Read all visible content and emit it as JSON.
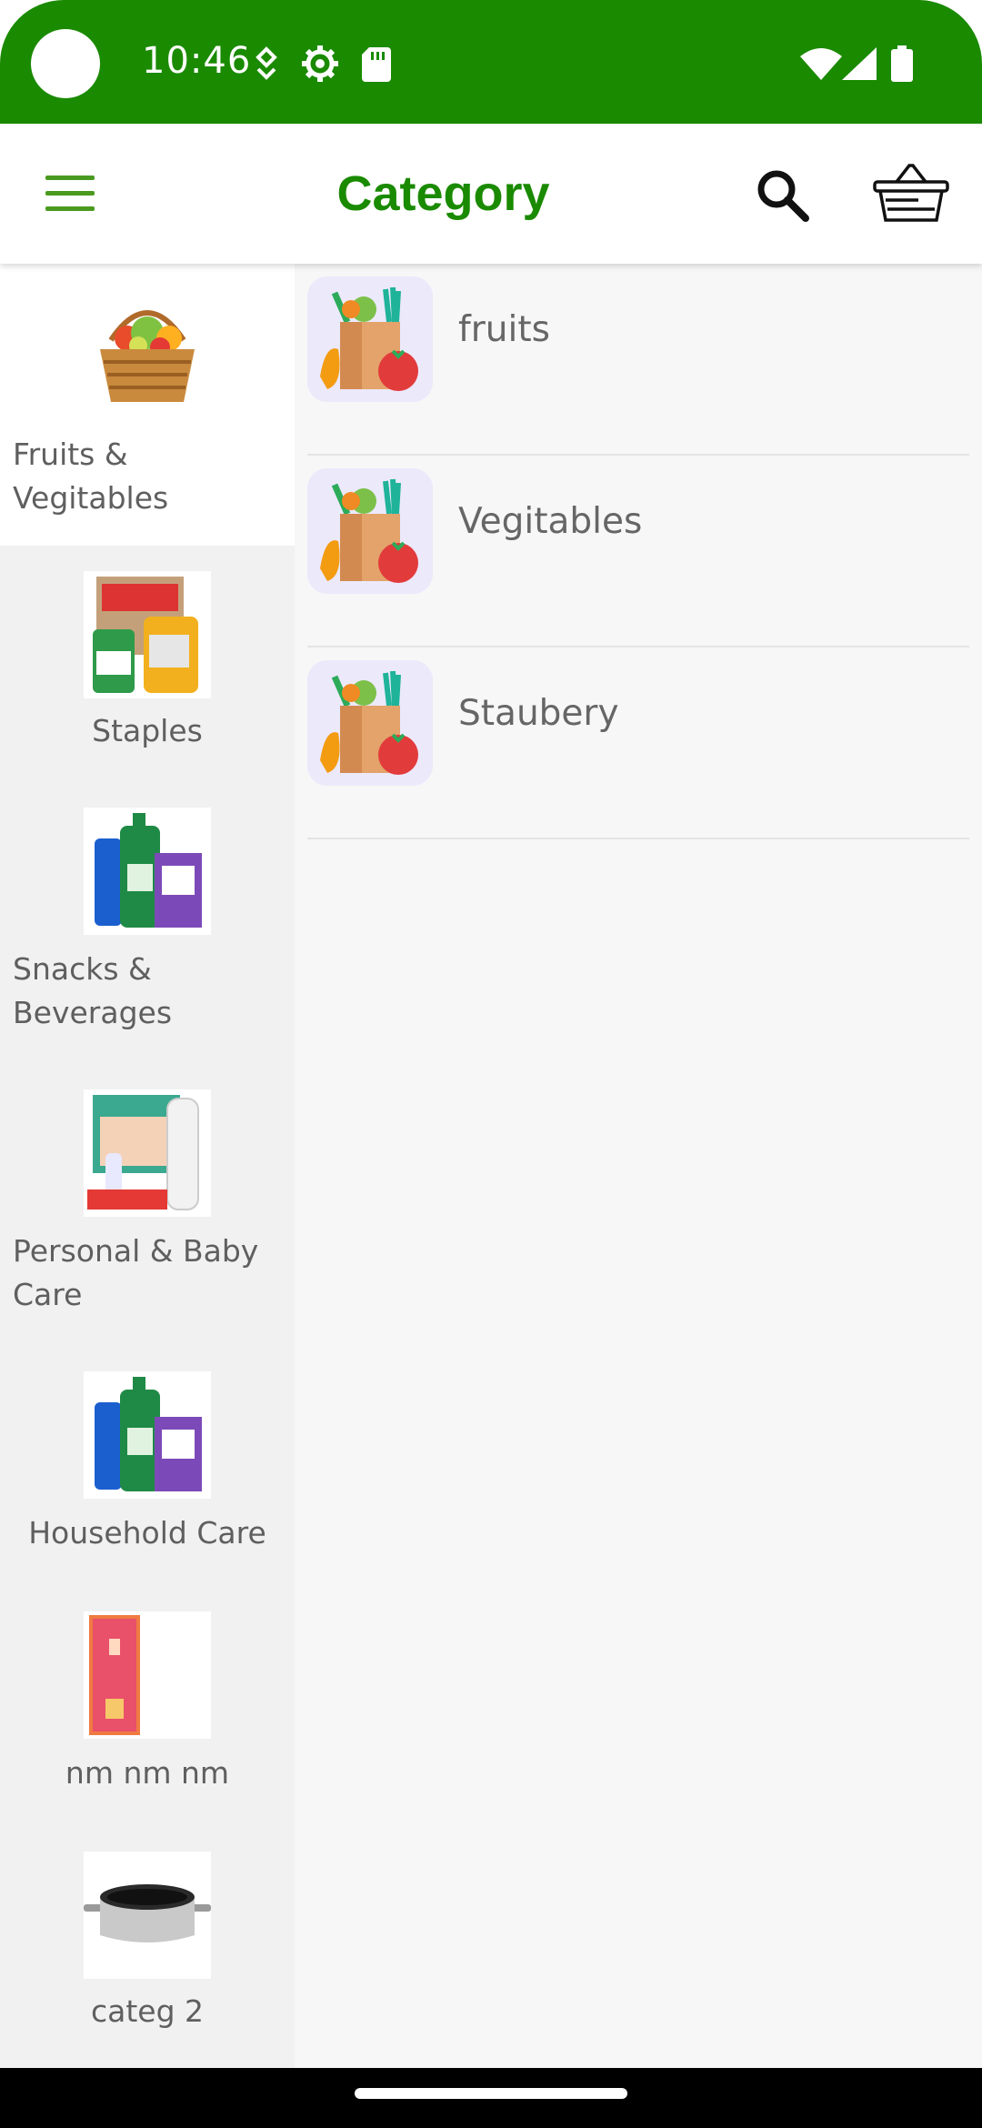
{
  "status_bar": {
    "time": "10:46",
    "icons": [
      "data-saver-icon",
      "settings-gear-icon",
      "sd-card-icon",
      "wifi-icon",
      "signal-icon",
      "battery-icon"
    ],
    "color": "#1a8a00"
  },
  "app_bar": {
    "title": "Category",
    "title_color": "#1a8a00",
    "icons": [
      "menu-icon",
      "search-icon",
      "basket-icon"
    ]
  },
  "sidebar": {
    "selected_index": 0,
    "items": [
      {
        "label": "Fruits & Vegitables",
        "thumb": "fruit-basket-image"
      },
      {
        "label": "Staples",
        "thumb": "staples-image"
      },
      {
        "label": "Snacks & Beverages",
        "thumb": "cleaning-products-image"
      },
      {
        "label": "Personal & Baby Care",
        "thumb": "baby-care-image"
      },
      {
        "label": "Household Care",
        "thumb": "household-products-image"
      },
      {
        "label": "nm nm nm",
        "thumb": "poster-image"
      },
      {
        "label": "categ 2",
        "thumb": "cooking-pot-image"
      }
    ]
  },
  "subcategories": [
    {
      "label": "fruits",
      "thumb": "grocery-bag-icon"
    },
    {
      "label": "Vegitables",
      "thumb": "grocery-bag-icon"
    },
    {
      "label": "Staubery",
      "thumb": "grocery-bag-icon"
    }
  ]
}
